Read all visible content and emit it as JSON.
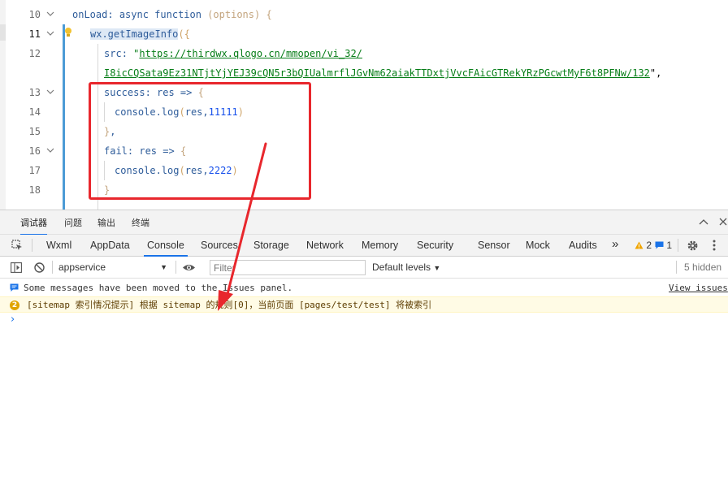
{
  "editor": {
    "lines": [
      {
        "num": "10",
        "indent": 89,
        "parts": [
          {
            "t": "onLoad",
            "c": "plain"
          },
          {
            "t": ": ",
            "c": "plain"
          },
          {
            "t": "async",
            "c": "plain"
          },
          {
            "t": " ",
            "c": "plain"
          },
          {
            "t": "function",
            "c": "plain"
          },
          {
            "t": " ",
            "c": "plain"
          },
          {
            "t": "(options)",
            "c": "param"
          },
          {
            "t": " {",
            "c": "param"
          }
        ]
      },
      {
        "num": "11",
        "indent": 111,
        "active": true,
        "parts": [
          {
            "t": "wx.getImageInfo",
            "c": "plain hl-prop"
          },
          {
            "t": "({",
            "c": "paren"
          }
        ]
      },
      {
        "num": "12",
        "indent": 128,
        "parts": [
          {
            "t": "src",
            "c": "plain"
          },
          {
            "t": ": ",
            "c": "plain"
          },
          {
            "t": "\"",
            "c": "str-q"
          },
          {
            "t": "https://thirdwx.qlogo.cn/mmopen/vi_32/",
            "c": "str"
          }
        ]
      },
      {
        "num": "",
        "indent": 128,
        "parts": [
          {
            "t": "I8icCQSata9Ez31NTjtYjYEJ39cQN5r3bQIUalmrflJGvNm62aiakTTDxtjVvcFAicGTRekYRzPGcwtMyF6t8PFNw/132",
            "c": "str"
          },
          {
            "t": "\",",
            "c": "punc"
          }
        ]
      },
      {
        "num": "13",
        "indent": 128,
        "parts": [
          {
            "t": "success",
            "c": "plain"
          },
          {
            "t": ": res => ",
            "c": "plain"
          },
          {
            "t": "{",
            "c": "param"
          }
        ]
      },
      {
        "num": "14",
        "indent": 141,
        "parts": [
          {
            "t": "console.log",
            "c": "plain"
          },
          {
            "t": "(",
            "c": "paren"
          },
          {
            "t": "res,",
            "c": "plain"
          },
          {
            "t": "11111",
            "c": "num"
          },
          {
            "t": ")",
            "c": "paren"
          }
        ]
      },
      {
        "num": "15",
        "indent": 128,
        "parts": [
          {
            "t": "}",
            "c": "param"
          },
          {
            "t": ",",
            "c": "plain"
          }
        ]
      },
      {
        "num": "16",
        "indent": 128,
        "parts": [
          {
            "t": "fail",
            "c": "plain"
          },
          {
            "t": ": res => ",
            "c": "plain"
          },
          {
            "t": "{",
            "c": "param"
          }
        ]
      },
      {
        "num": "17",
        "indent": 141,
        "parts": [
          {
            "t": "console.log",
            "c": "plain"
          },
          {
            "t": "(",
            "c": "paren"
          },
          {
            "t": "res,",
            "c": "plain"
          },
          {
            "t": "2222",
            "c": "num"
          },
          {
            "t": ")",
            "c": "paren"
          }
        ]
      },
      {
        "num": "18",
        "indent": 128,
        "parts": [
          {
            "t": "}",
            "c": "param"
          }
        ]
      }
    ]
  },
  "panel_tabs": [
    "调试器",
    "问题",
    "输出",
    "终端"
  ],
  "devtools": {
    "tabs": [
      "Wxml",
      "AppData",
      "Console",
      "Sources",
      "Storage",
      "Network",
      "Memory",
      "Security",
      "Sensor",
      "Mock",
      "Audits"
    ],
    "active_tab": "Console",
    "more": "»",
    "warning_count": "2",
    "info_count": "1"
  },
  "console": {
    "context": "appservice",
    "filter_placeholder": "Filter",
    "levels": "Default levels",
    "hidden": "5 hidden",
    "messages": [
      {
        "type": "info",
        "text": "Some messages have been moved to the Issues panel.",
        "link": "View issues"
      },
      {
        "type": "warn",
        "badge": "2",
        "text": "[sitemap 索引情况提示] 根据 sitemap 的规则[0]，当前页面 [pages/test/test] 将被索引"
      }
    ],
    "prompt": "›"
  },
  "colors": {
    "annotation": "#e8272d",
    "accent": "#1a73e8"
  }
}
